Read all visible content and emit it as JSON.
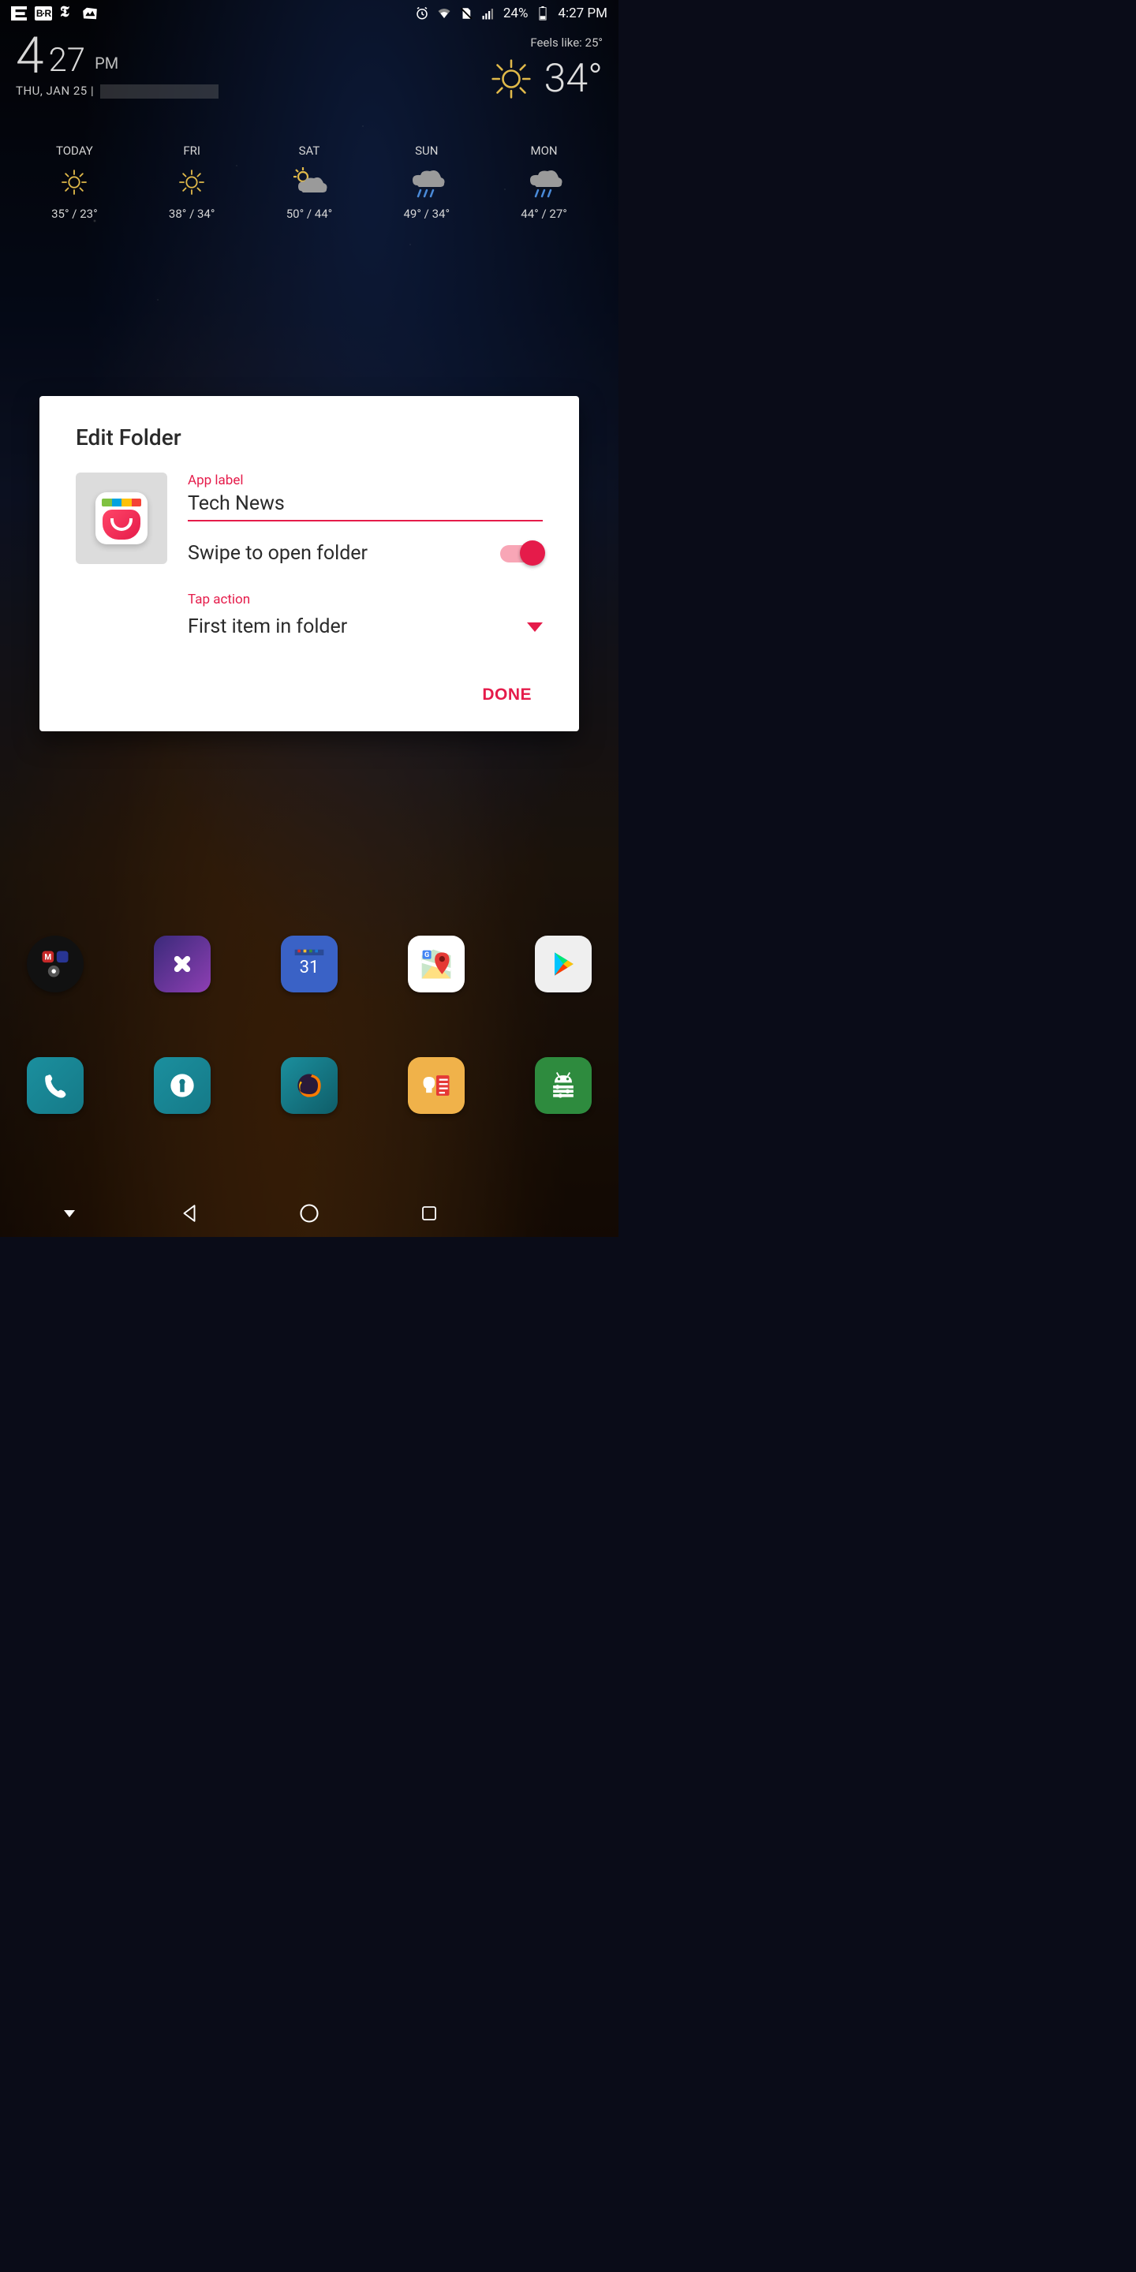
{
  "statusbar": {
    "battery_pct": "24%",
    "time": "4:27 PM",
    "icons_left": [
      "espn",
      "br",
      "nyt",
      "photos"
    ],
    "icons_right": [
      "alarm",
      "wifi",
      "sd-off",
      "signal",
      "battery"
    ]
  },
  "clock": {
    "hour": "4",
    "minute": "27",
    "ampm": "PM",
    "date": "THU, JAN 25 |"
  },
  "weather": {
    "feels_like": "Feels like: 25°",
    "temp": "34°",
    "forecast": [
      {
        "day": "TODAY",
        "icon": "sun",
        "hi_lo": "35° / 23°"
      },
      {
        "day": "FRI",
        "icon": "sun",
        "hi_lo": "38° / 34°"
      },
      {
        "day": "SAT",
        "icon": "partly",
        "hi_lo": "50° / 44°"
      },
      {
        "day": "SUN",
        "icon": "rain",
        "hi_lo": "49° / 34°"
      },
      {
        "day": "MON",
        "icon": "rain",
        "hi_lo": "44° / 27°"
      }
    ]
  },
  "dialog": {
    "title": "Edit Folder",
    "app_label_caption": "App label",
    "app_label_value": "Tech News",
    "swipe_label": "Swipe to open folder",
    "swipe_on": true,
    "tap_action_caption": "Tap action",
    "tap_action_value": "First item in folder",
    "done_label": "DONE"
  },
  "apps_row2": [
    {
      "name": "folder-circle",
      "color": "#1a1a1a"
    },
    {
      "name": "slack",
      "color": "linear-gradient(135deg,#4e2c8e,#8e3fb3)"
    },
    {
      "name": "calendar-31",
      "color": "#3a62c6"
    },
    {
      "name": "google-maps",
      "color": "#ffffff"
    },
    {
      "name": "play-store",
      "color": "#efefef"
    }
  ],
  "dock": [
    {
      "name": "phone",
      "color": "#1b8f9e"
    },
    {
      "name": "keyhole",
      "color": "#1b8f9e"
    },
    {
      "name": "firefox",
      "color": "#1b8f9e"
    },
    {
      "name": "keep",
      "color": "#f0b24a"
    },
    {
      "name": "android",
      "color": "#2e8b3e"
    }
  ],
  "calendar_day": "31"
}
